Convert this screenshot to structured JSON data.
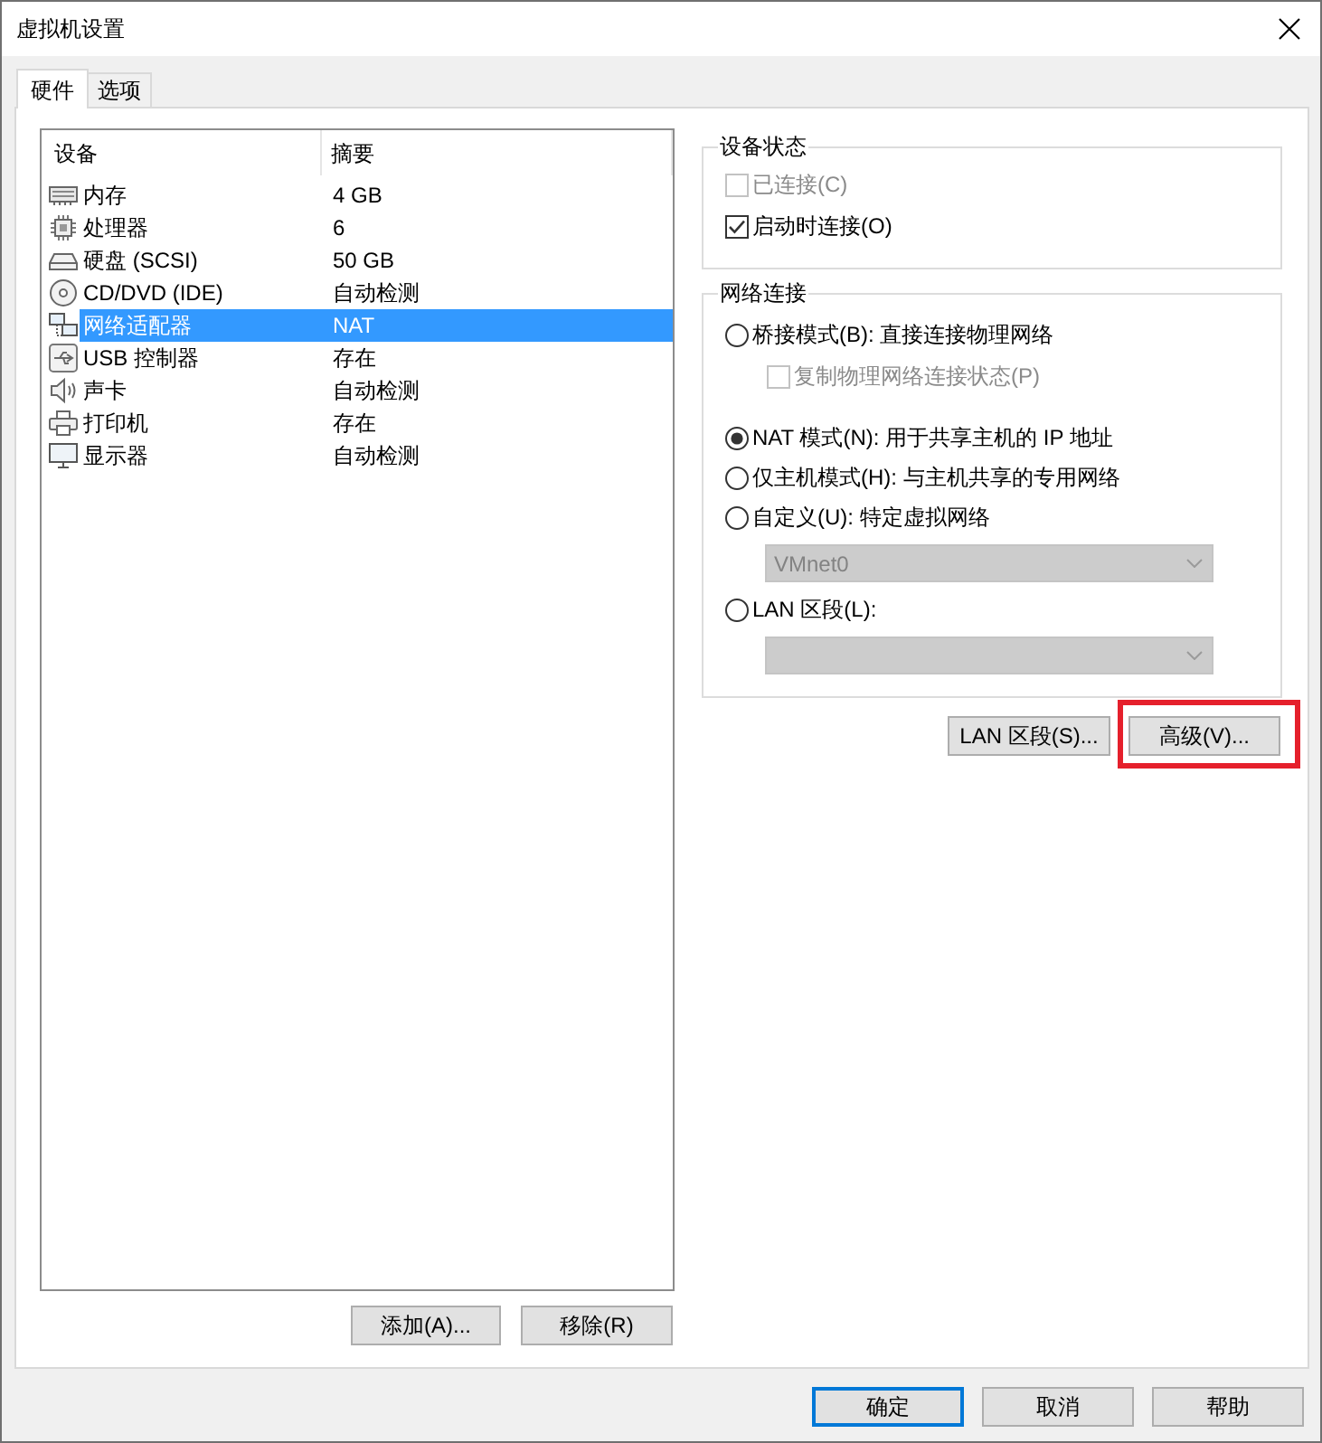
{
  "window": {
    "title": "虚拟机设置"
  },
  "tabs": [
    {
      "label": "硬件",
      "selected": true
    },
    {
      "label": "选项",
      "selected": false
    }
  ],
  "device_list": {
    "columns": [
      "设备",
      "摘要"
    ],
    "rows": [
      {
        "kind": "memory",
        "device": "内存",
        "summary": "4 GB",
        "selected": false
      },
      {
        "kind": "processor",
        "device": "处理器",
        "summary": "6",
        "selected": false
      },
      {
        "kind": "disk",
        "device": "硬盘 (SCSI)",
        "summary": "50 GB",
        "selected": false
      },
      {
        "kind": "cdrom",
        "device": "CD/DVD (IDE)",
        "summary": "自动检测",
        "selected": false
      },
      {
        "kind": "network",
        "device": "网络适配器",
        "summary": "NAT",
        "selected": true
      },
      {
        "kind": "usb",
        "device": "USB 控制器",
        "summary": "存在",
        "selected": false
      },
      {
        "kind": "sound",
        "device": "声卡",
        "summary": "自动检测",
        "selected": false
      },
      {
        "kind": "printer",
        "device": "打印机",
        "summary": "存在",
        "selected": false
      },
      {
        "kind": "display",
        "device": "显示器",
        "summary": "自动检测",
        "selected": false
      }
    ]
  },
  "list_buttons": [
    "添加(A)...",
    "移除(R)"
  ],
  "device_status": {
    "title": "设备状态",
    "options": [
      {
        "label": "已连接(C)",
        "checked": false,
        "disabled": true
      },
      {
        "label": "启动时连接(O)",
        "checked": true,
        "disabled": false
      }
    ]
  },
  "network_connection": {
    "title": "网络连接",
    "items": [
      {
        "kind": "radio",
        "label": "桥接模式(B): 直接连接物理网络",
        "selected": false
      },
      {
        "kind": "checkbox",
        "label": "复制物理网络连接状态(P)",
        "checked": false,
        "disabled": true
      },
      {
        "kind": "radio",
        "label": "NAT 模式(N): 用于共享主机的 IP 地址",
        "selected": true
      },
      {
        "kind": "radio",
        "label": "仅主机模式(H): 与主机共享的专用网络",
        "selected": false
      },
      {
        "kind": "radio",
        "label": "自定义(U): 特定虚拟网络",
        "selected": false
      },
      {
        "kind": "dropdown",
        "value": "VMnet0",
        "disabled": true
      },
      {
        "kind": "radio",
        "label": "LAN 区段(L):",
        "selected": false
      },
      {
        "kind": "dropdown",
        "disabled": true
      }
    ]
  },
  "network_buttons": [
    {
      "label": "LAN 区段(S)...",
      "highlighted": false
    },
    {
      "label": "高级(V)...",
      "highlighted": true
    }
  ],
  "dialog_buttons": [
    {
      "label": "确定",
      "default": true
    },
    {
      "label": "取消",
      "default": false
    },
    {
      "label": "帮助",
      "default": false
    }
  ]
}
